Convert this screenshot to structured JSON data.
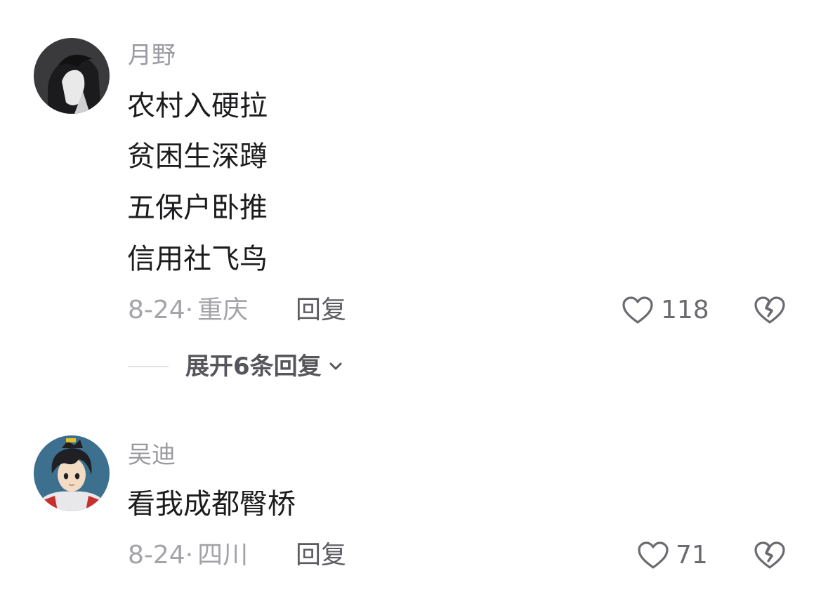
{
  "comments": [
    {
      "username": "月野",
      "avatar": "dark-silhouette-avatar",
      "lines": [
        "农村入硬拉",
        "贫困生深蹲",
        "五保户卧推",
        "信用社飞鸟"
      ],
      "date": "8-24",
      "location": "重庆",
      "reply_label": "回复",
      "likes": "118",
      "expand_label": "展开6条回复"
    },
    {
      "username": "吴迪",
      "avatar": "anime-boy-avatar",
      "lines": [
        "看我成都臀桥"
      ],
      "date": "8-24",
      "location": "四川",
      "reply_label": "回复",
      "likes": "71"
    }
  ],
  "separator": "·",
  "colors": {
    "username": "#9a9aa0",
    "content": "#1c1c1e",
    "meta": "#a3a3a8",
    "reply": "#5c5c62",
    "icon": "#6a6a70"
  },
  "icons": {
    "like": "heart-outline-icon",
    "dislike": "broken-heart-icon",
    "expand": "chevron-down-icon"
  }
}
